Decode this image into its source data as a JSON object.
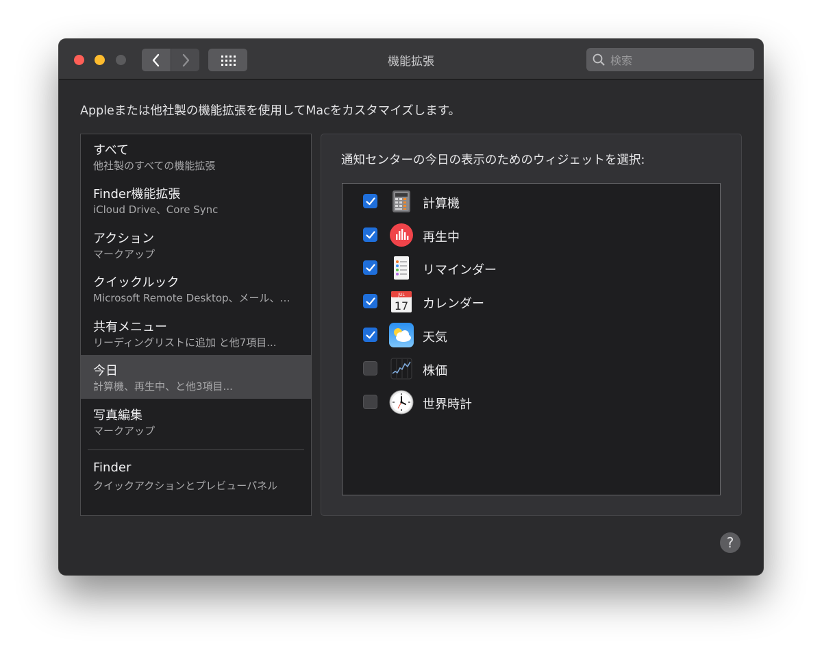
{
  "window": {
    "title": "機能拡張",
    "search_placeholder": "検索"
  },
  "headline": "Appleまたは他社製の機能拡張を使用してMacをカスタマイズします。",
  "sidebar": {
    "items": [
      {
        "title": "すべて",
        "subtitle": "他社製のすべての機能拡張"
      },
      {
        "title": "Finder機能拡張",
        "subtitle": "iCloud Drive、Core Sync"
      },
      {
        "title": "アクション",
        "subtitle": "マークアップ"
      },
      {
        "title": "クイックルック",
        "subtitle": "Microsoft Remote Desktop、メール、…"
      },
      {
        "title": "共有メニュー",
        "subtitle": "リーディングリストに追加 と他7項目..."
      },
      {
        "title": "今日",
        "subtitle": "計算機、再生中、と他3項目..."
      },
      {
        "title": "写真編集",
        "subtitle": "マークアップ"
      },
      {
        "title": "Finder",
        "subtitle": "クイックアクションとプレビューパネル"
      }
    ],
    "selected_index": 5
  },
  "panel": {
    "title": "通知センターの今日の表示のためのウィジェットを選択:",
    "widgets": [
      {
        "label": "計算機",
        "checked": true,
        "icon": "calculator-icon"
      },
      {
        "label": "再生中",
        "checked": true,
        "icon": "now-playing-icon"
      },
      {
        "label": "リマインダー",
        "checked": true,
        "icon": "reminders-icon"
      },
      {
        "label": "カレンダー",
        "checked": true,
        "icon": "calendar-icon",
        "icon_month": "JUL",
        "icon_day": "17"
      },
      {
        "label": "天気",
        "checked": true,
        "icon": "weather-icon"
      },
      {
        "label": "株価",
        "checked": false,
        "icon": "stocks-icon"
      },
      {
        "label": "世界時計",
        "checked": false,
        "icon": "world-clock-icon"
      }
    ]
  },
  "help_label": "?",
  "colors": {
    "accent": "#1f6fdb",
    "window_bg": "#2b2b2d",
    "selection": "#464649"
  }
}
